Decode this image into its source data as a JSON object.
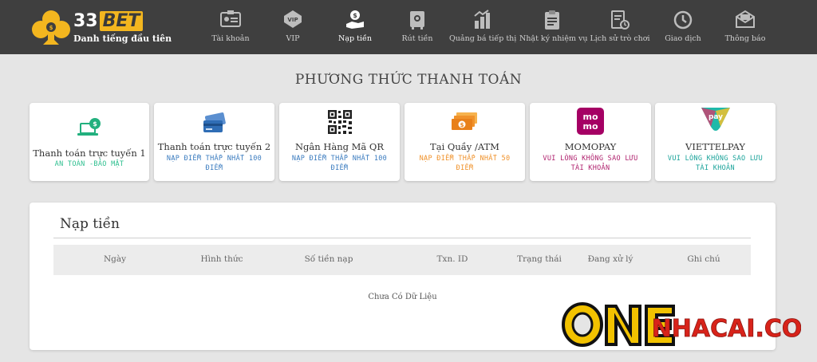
{
  "brand": {
    "name_prefix": "33",
    "name_suffix": "BET",
    "tagline": "Danh tiếng đầu tiên"
  },
  "nav": [
    {
      "label": "Tài khoản",
      "icon": "id-card-icon",
      "active": false
    },
    {
      "label": "VIP",
      "icon": "vip-badge-icon",
      "active": false
    },
    {
      "label": "Nạp tiền",
      "icon": "deposit-hand-icon",
      "active": true
    },
    {
      "label": "Rút tiền",
      "icon": "withdraw-safe-icon",
      "active": false
    },
    {
      "label": "Quảng bá tiếp thị",
      "icon": "promotion-chart-icon",
      "active": false
    },
    {
      "label": "Nhật ký nhiệm vụ",
      "icon": "clipboard-icon",
      "active": false
    },
    {
      "label": "Lịch sử trò chơi",
      "icon": "history-document-icon",
      "active": false
    },
    {
      "label": "Giao dịch",
      "icon": "clock-icon",
      "active": false
    },
    {
      "label": "Thông báo",
      "icon": "envelope-icon",
      "active": false
    }
  ],
  "page_title": "PHƯƠNG THỨC THANH TOÁN",
  "methods": [
    {
      "name": "Thanh toán trực tuyến 1",
      "note": "AN TOÀN -BẢO MẬT",
      "color": "#2dbf8f",
      "icon": "laptop-dollar-icon"
    },
    {
      "name": "Thanh toán trực tuyến 2",
      "note": "NẠP ĐIỂM THẤP NHẤT 100 ĐIỂM",
      "color": "#3a7bbf",
      "icon": "credit-cards-icon"
    },
    {
      "name": "Ngân Hàng Mã QR",
      "note": "NẠP ĐIỂM THẤP NHẤT 100 ĐIỂM",
      "color": "#3a7bbf",
      "icon": "qr-code-icon"
    },
    {
      "name": "Tại Quầy /ATM",
      "note": "NẠP ĐIỂM THẤP NHẤT 50 ĐIỂM",
      "color": "#f0922b",
      "icon": "cash-stack-icon"
    },
    {
      "name": "MOMOPAY",
      "note": "VUI LÒNG KHÔNG SAO LƯU TÀI KHOẢN",
      "color": "#b0226e",
      "icon": "momo-logo-icon"
    },
    {
      "name": "VIETTELPAY",
      "note": "VUI LÒNG KHÔNG SAO LƯU TÀI KHOẢN",
      "color": "#1aa39a",
      "icon": "viettelpay-logo-icon"
    }
  ],
  "deposit_panel": {
    "title": "Nạp tiền",
    "columns": [
      "Ngày",
      "Hình thức",
      "Số tiền nạp",
      "Txn. ID",
      "Trạng thái",
      "Đang xử lý",
      "Ghi chú"
    ],
    "empty_text": "Chưa Có Dữ Liệu"
  },
  "watermark": {
    "text": "NHACAI.COM"
  }
}
